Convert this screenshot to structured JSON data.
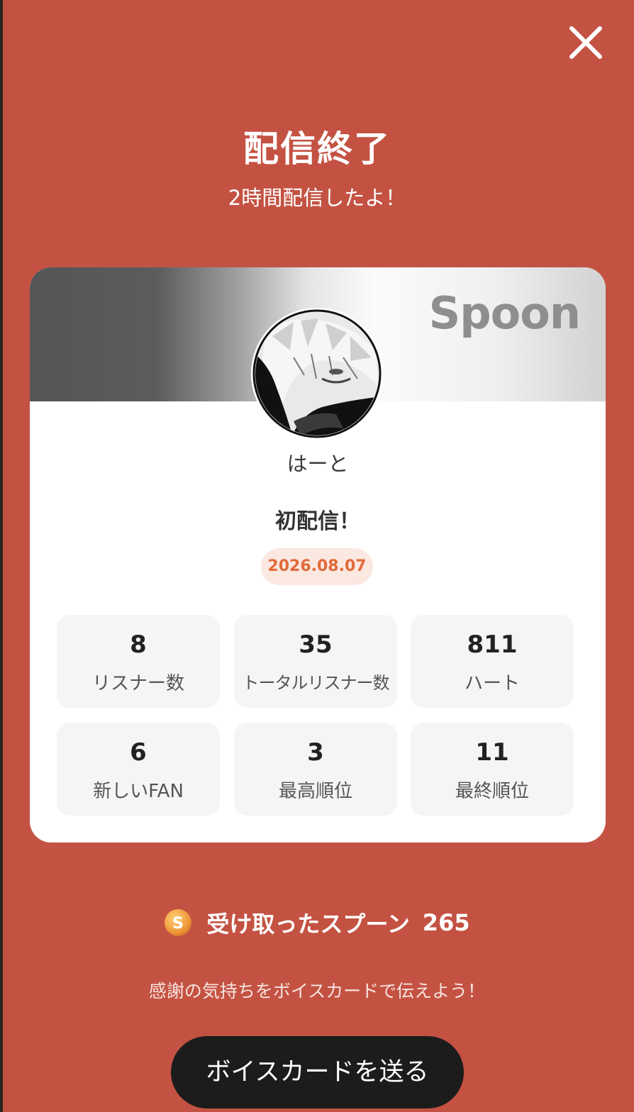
{
  "header": {
    "title": "配信終了",
    "subtitle": "2時間配信したよ！",
    "close_icon": "close-icon"
  },
  "card": {
    "brand": "Spoon",
    "username": "はーと",
    "stream_title": "初配信！",
    "date": "2026.08.07",
    "stats": [
      {
        "value": "8",
        "label": "リスナー数"
      },
      {
        "value": "35",
        "label": "トータルリスナー数"
      },
      {
        "value": "811",
        "label": "ハート"
      },
      {
        "value": "6",
        "label": "新しいFAN"
      },
      {
        "value": "3",
        "label": "最高順位"
      },
      {
        "value": "11",
        "label": "最終順位"
      }
    ]
  },
  "spoons": {
    "icon": "spoon-coin-icon",
    "coin_letter": "S",
    "label": "受け取ったスプーン",
    "count": "265"
  },
  "footer": {
    "thanks_text": "感謝の気持ちをボイスカードで伝えよう！",
    "voice_card_button": "ボイスカードを送る"
  },
  "colors": {
    "background": "#c45242",
    "card": "#ffffff",
    "date_text": "#e26a3a",
    "date_bg": "#fbe8e1",
    "button": "#1c1c1c"
  }
}
